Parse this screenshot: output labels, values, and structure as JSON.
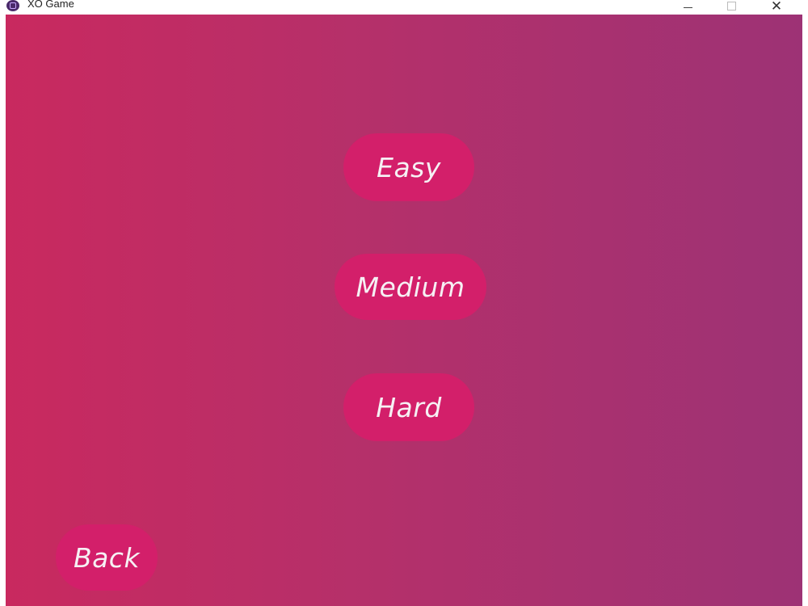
{
  "window": {
    "title": "XO Game",
    "controls": {
      "minimize": "minimize-icon",
      "maximize": "maximize-icon",
      "close": "close-icon"
    }
  },
  "theme": {
    "gradient_start": "#c9295f",
    "gradient_end": "#9d3275",
    "button_color": "#d31f6a",
    "text_color": "#f6f0f4"
  },
  "difficulty": {
    "easy_label": "Easy",
    "medium_label": "Medium",
    "hard_label": "Hard"
  },
  "navigation": {
    "back_label": "Back"
  }
}
